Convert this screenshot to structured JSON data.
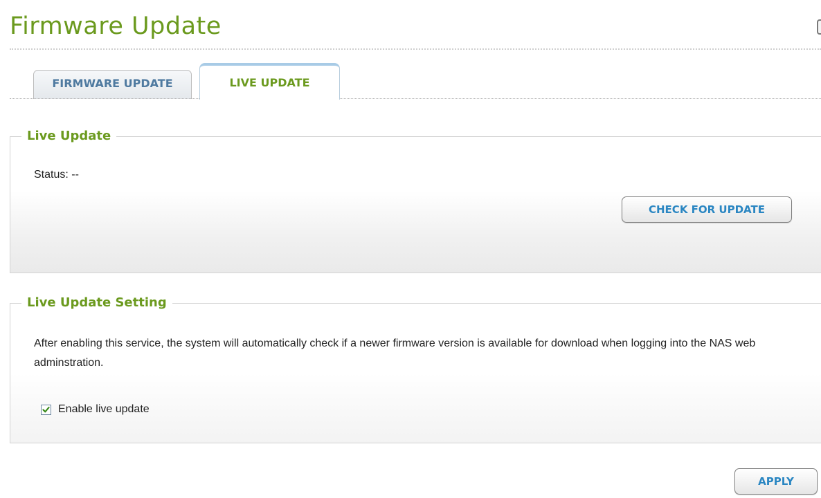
{
  "page": {
    "title": "Firmware Update"
  },
  "tabs": [
    {
      "label": "FIRMWARE UPDATE",
      "active": false
    },
    {
      "label": "LIVE UPDATE",
      "active": true
    }
  ],
  "live_update": {
    "legend": "Live Update",
    "status_text": "Status: --",
    "check_button_label": "CHECK FOR UPDATE"
  },
  "live_update_setting": {
    "legend": "Live Update Setting",
    "description": "After enabling this service, the system will automatically check if a newer firmware version is available for download when logging into the NAS web adminstration.",
    "enable_label": "Enable live update",
    "enable_checked": true
  },
  "footer": {
    "apply_label": "APPLY"
  },
  "colors": {
    "accent_green": "#6b9a1e",
    "tab_blue": "#4f7aa0",
    "button_text_blue": "#2a86c2",
    "check_green": "#3a8a1c"
  },
  "icons": {
    "corner_widget": "window-control-icon",
    "checkmark": "checkmark-icon"
  }
}
